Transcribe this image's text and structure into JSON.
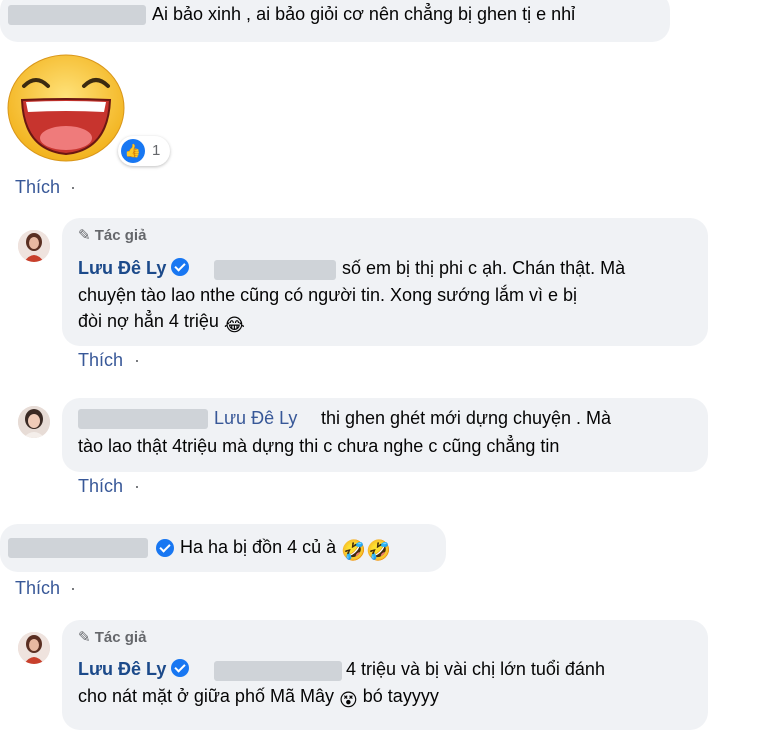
{
  "comments": [
    {
      "text": "Ai bảo xinh , ai bảo giỏi cơ nên chẳng bị ghen tị e nhỉ",
      "reaction_count": "1",
      "action": "Thích",
      "separator": "·"
    },
    {
      "author_badge": "Tác giả",
      "author": "Lưu Đê Ly",
      "lines": [
        "số em bị thị phi c ạh. Chán thật. Mà",
        "chuyện tào lao nthe cũng có người tin. Xong sướng lắm vì e bị",
        "đòi nợ hẳn 4 triệu"
      ],
      "action": "Thích",
      "separator": "·"
    },
    {
      "mention": "Lưu Đê Ly",
      "lines": [
        "thi ghen ghét mới dựng chuyện . Mà",
        "tào lao thật 4triệu mà dựng thi c chưa nghe c cũng chẳng tin"
      ],
      "action": "Thích",
      "separator": "·"
    },
    {
      "text": "Ha ha bị đồn 4 củ à",
      "action": "Thích",
      "separator": "·"
    },
    {
      "author_badge": "Tác giả",
      "author": "Lưu Đê Ly",
      "lines": [
        "4 triệu và bị vài chị lớn tuổi đánh",
        "cho nát mặt ở giữa phố Mã Mây",
        "bó tayyyy"
      ]
    }
  ],
  "colors": {
    "bubble": "#f0f2f5",
    "name": "#1c4a8a",
    "link": "#385898",
    "meta": "#65676b",
    "verified": "#1877f2"
  }
}
